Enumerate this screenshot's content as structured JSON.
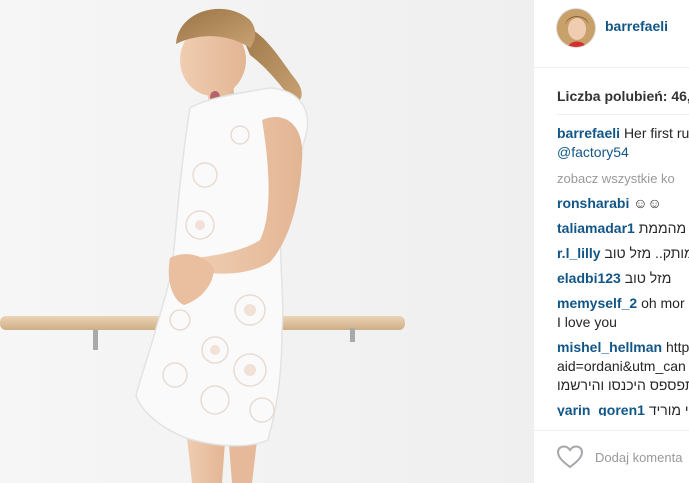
{
  "post": {
    "username": "barrefaeli",
    "likes_label": "Liczba polubień: 46,",
    "caption": {
      "username": "barrefaeli",
      "text": "Her first ru",
      "mention": "@factory54"
    },
    "view_all_label": "zobacz wszystkie ko",
    "comments": [
      {
        "user": "ronsharabi",
        "text": "☺☺"
      },
      {
        "user": "taliamadar1",
        "text": "מהממת"
      },
      {
        "user": "r.l_lilly",
        "text": "מותק.. מזל טוב"
      },
      {
        "user": "eladbi123",
        "text": "מזל טוב"
      },
      {
        "user": "memyself_2",
        "text": "oh mor",
        "text2": "I love you"
      },
      {
        "user": "mishel_hellman",
        "text": "http",
        "text2": "aid=ordani&utm_can",
        "text3": "תפספס היכנסו והירשמו"
      },
      {
        "user": "yarin_goren1",
        "text": "י מוריד"
      }
    ],
    "add_comment_placeholder": "Dodaj komenta"
  },
  "colors": {
    "link": "#125688",
    "muted": "#999999",
    "border": "#efefef"
  },
  "icons": {
    "like": "heart-outline-icon"
  }
}
